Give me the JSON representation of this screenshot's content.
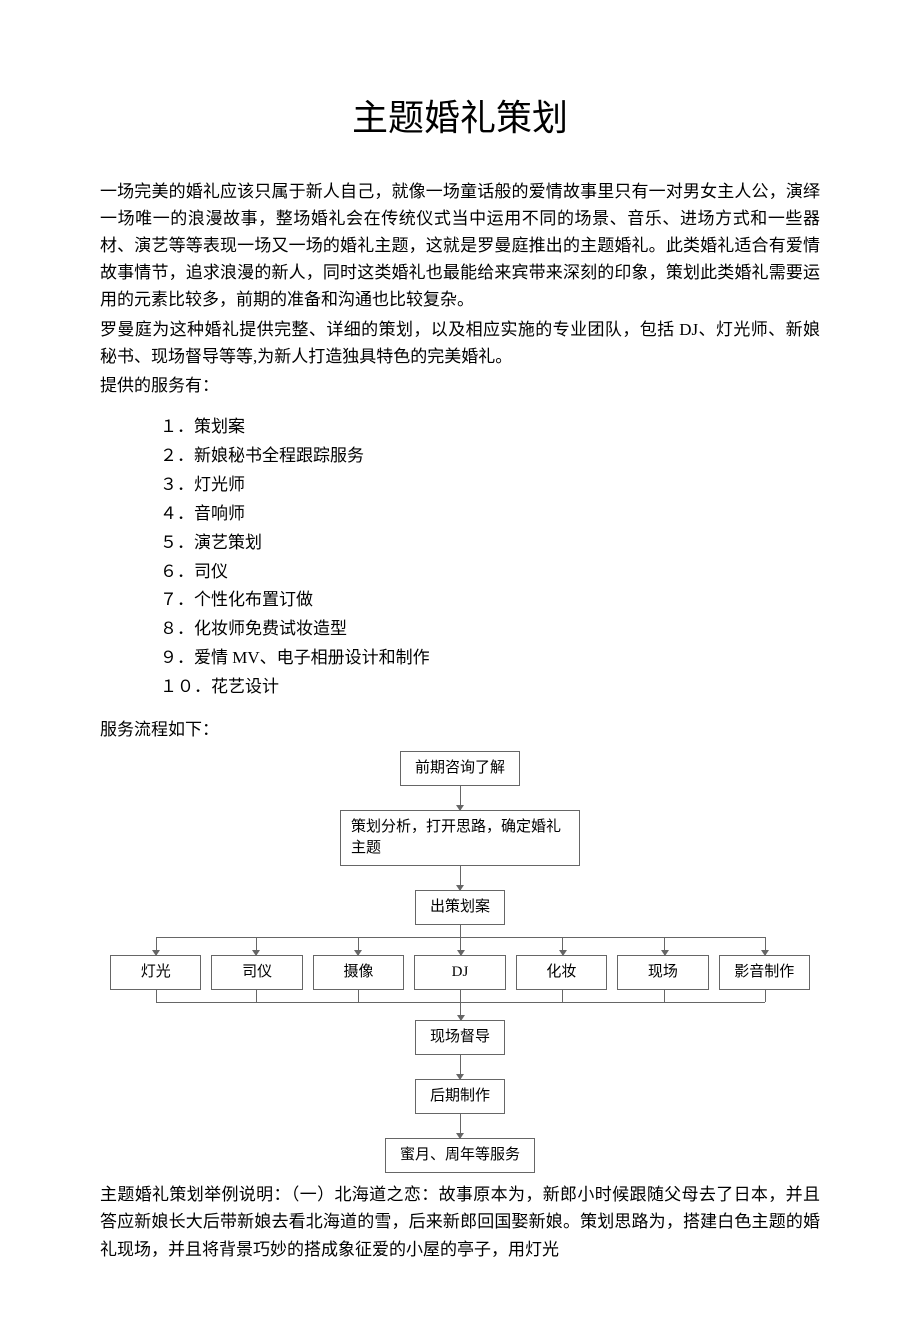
{
  "title": "主题婚礼策划",
  "intro": {
    "p1": "一场完美的婚礼应该只属于新人自己，就像一场童话般的爱情故事里只有一对男女主人公，演绎一场唯一的浪漫故事，整场婚礼会在传统仪式当中运用不同的场景、音乐、进场方式和一些器材、演艺等等表现一场又一场的婚礼主题，这就是罗曼庭推出的主题婚礼。此类婚礼适合有爱情故事情节，追求浪漫的新人，同时这类婚礼也最能给来宾带来深刻的印象，策划此类婚礼需要运用的元素比较多，前期的准备和沟通也比较复杂。",
    "p2": "罗曼庭为这种婚礼提供完整、详细的策划，以及相应实施的专业团队，包括 DJ、灯光师、新娘秘书、现场督导等等,为新人打造独具特色的完美婚礼。",
    "p3": "提供的服务有："
  },
  "services": [
    "１．策划案",
    "２．新娘秘书全程跟踪服务",
    "３．灯光师",
    "４．音响师",
    "５．演艺策划",
    "６．司仪",
    "７．个性化布置订做",
    "８．化妆师免费试妆造型",
    "９．爱情 MV、电子相册设计和制作",
    "１０．花艺设计"
  ],
  "flow_label": "服务流程如下：",
  "flow": {
    "step1": "前期咨询了解",
    "step2": "策划分析，打开思路，确定婚礼主题",
    "step3": "出策划案",
    "branches": [
      "灯光",
      "司仪",
      "摄像",
      "DJ",
      "化妆",
      "现场",
      "影音制作"
    ],
    "step5": "现场督导",
    "step6": "后期制作",
    "step7": "蜜月、周年等服务"
  },
  "example": "主题婚礼策划举例说明：（一）北海道之恋：故事原本为，新郎小时候跟随父母去了日本，并且答应新娘长大后带新娘去看北海道的雪，后来新郎回国娶新娘。策划思路为，搭建白色主题的婚礼现场，并且将背景巧妙的搭成象征爱的小屋的亭子，用灯光",
  "chart_data": {
    "type": "flowchart",
    "nodes": [
      {
        "id": "n1",
        "label": "前期咨询了解"
      },
      {
        "id": "n2",
        "label": "策划分析，打开思路，确定婚礼主题"
      },
      {
        "id": "n3",
        "label": "出策划案"
      },
      {
        "id": "b1",
        "label": "灯光"
      },
      {
        "id": "b2",
        "label": "司仪"
      },
      {
        "id": "b3",
        "label": "摄像"
      },
      {
        "id": "b4",
        "label": "DJ"
      },
      {
        "id": "b5",
        "label": "化妆"
      },
      {
        "id": "b6",
        "label": "现场"
      },
      {
        "id": "b7",
        "label": "影音制作"
      },
      {
        "id": "n5",
        "label": "现场督导"
      },
      {
        "id": "n6",
        "label": "后期制作"
      },
      {
        "id": "n7",
        "label": "蜜月、周年等服务"
      }
    ],
    "edges": [
      [
        "n1",
        "n2"
      ],
      [
        "n2",
        "n3"
      ],
      [
        "n3",
        "b1"
      ],
      [
        "n3",
        "b2"
      ],
      [
        "n3",
        "b3"
      ],
      [
        "n3",
        "b4"
      ],
      [
        "n3",
        "b5"
      ],
      [
        "n3",
        "b6"
      ],
      [
        "n3",
        "b7"
      ],
      [
        "b1",
        "n5"
      ],
      [
        "b2",
        "n5"
      ],
      [
        "b3",
        "n5"
      ],
      [
        "b4",
        "n5"
      ],
      [
        "b5",
        "n5"
      ],
      [
        "b6",
        "n5"
      ],
      [
        "b7",
        "n5"
      ],
      [
        "n5",
        "n6"
      ],
      [
        "n6",
        "n7"
      ]
    ]
  }
}
